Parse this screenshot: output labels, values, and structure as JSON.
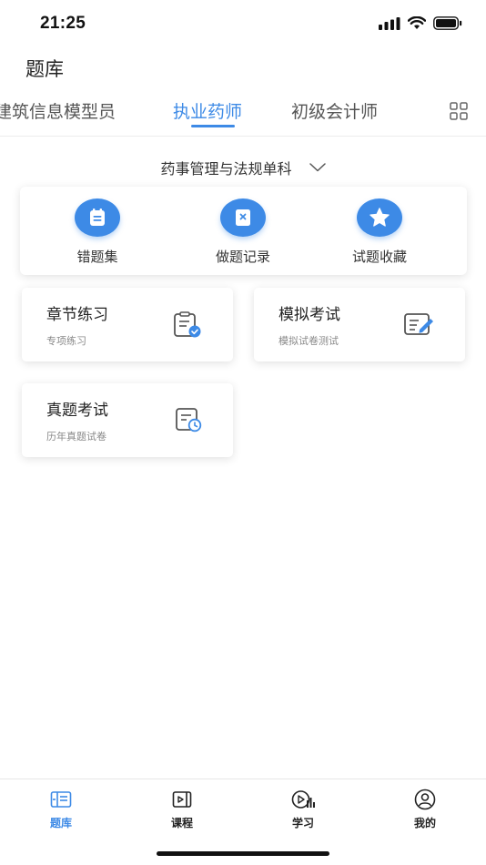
{
  "status_bar": {
    "time": "21:25"
  },
  "header": {
    "title": "题库"
  },
  "tabs": [
    {
      "label": "建筑信息模型员"
    },
    {
      "label": "执业药师"
    },
    {
      "label": "初级会计师"
    }
  ],
  "subject": {
    "label": "药事管理与法规单科"
  },
  "quick_actions": [
    {
      "label": "错题集",
      "icon": "notebook-icon"
    },
    {
      "label": "做题记录",
      "icon": "record-icon"
    },
    {
      "label": "试题收藏",
      "icon": "star-icon"
    }
  ],
  "practice_cards": [
    {
      "title": "章节练习",
      "subtitle": "专项练习",
      "icon": "clipboard-check-icon"
    },
    {
      "title": "模拟考试",
      "subtitle": "模拟试卷测试",
      "icon": "edit-note-icon"
    },
    {
      "title": "真题考试",
      "subtitle": "历年真题试卷",
      "icon": "clock-doc-icon"
    }
  ],
  "bottom_nav": [
    {
      "label": "题库",
      "icon": "question-bank-icon"
    },
    {
      "label": "课程",
      "icon": "course-icon"
    },
    {
      "label": "学习",
      "icon": "study-icon"
    },
    {
      "label": "我的",
      "icon": "profile-icon"
    }
  ],
  "colors": {
    "accent": "#3d8ae6",
    "text": "#222222",
    "muted": "#888888"
  }
}
